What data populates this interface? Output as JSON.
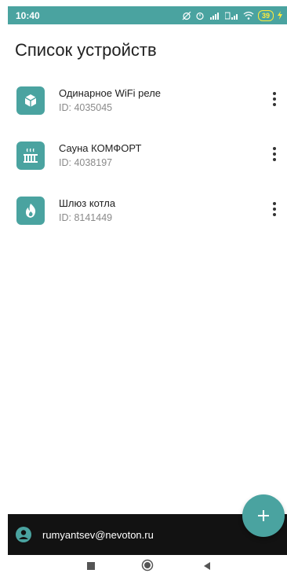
{
  "status": {
    "time": "10:40",
    "battery": "39"
  },
  "page": {
    "title": "Список устройств"
  },
  "devices": [
    {
      "name": "Одинарное WiFi реле",
      "id": "ID: 4035045",
      "icon": "cube-icon"
    },
    {
      "name": "Сауна КОМФОРТ",
      "id": "ID: 4038197",
      "icon": "sauna-icon"
    },
    {
      "name": "Шлюз котла",
      "id": "ID: 8141449",
      "icon": "flame-icon"
    }
  ],
  "account": {
    "email": "rumyantsev@nevoton.ru"
  },
  "colors": {
    "accent": "#4aa3a0",
    "bottom_bar": "#121212"
  }
}
